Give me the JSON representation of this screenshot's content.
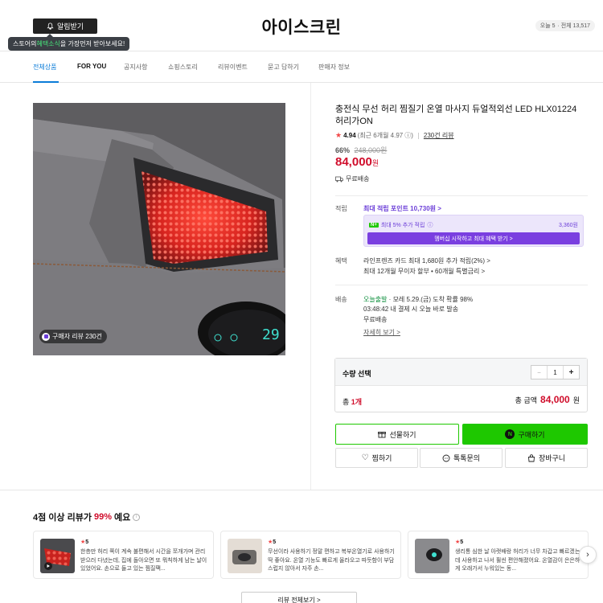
{
  "header": {
    "alarm_button": "알림받기",
    "alarm_tip_pre": "스토어의 ",
    "alarm_tip_highlight": "혜택소식",
    "alarm_tip_post": "을 가장먼저 받아보세요!",
    "store_name": "아이스크린",
    "visits_today": "오늘 5",
    "visits_total": "· 전체 13,517"
  },
  "nav": {
    "items": [
      "전체상품",
      "FOR YOU",
      "공지사항",
      "쇼핑스토리",
      "리뷰이벤트",
      "묻고 답하기",
      "판매자 정보"
    ]
  },
  "product": {
    "review_chip": "구매자 리뷰 230건",
    "title": "충전식 무선 허리 찜질기 온열 마사지 듀얼적외선 LED HLX01224 허리가ON",
    "rating": "4.94",
    "rating_sub": "(최근 6개월 4.97",
    "review_count": "230건 리뷰",
    "discount_pct": "66%",
    "original_price": "248,000원",
    "price": "84,000",
    "price_unit": "원",
    "shipping_free": "무료배송"
  },
  "benefits": {
    "points_label": "적립",
    "points_link": "최대 적립 포인트 10,730원 >",
    "npay_badge": "N+",
    "extra_points": "최대 5% 추가 적립",
    "extra_amount": "3,360원",
    "membership_button": "멤버십 시작하고 최대 혜택 받기 >",
    "card_label": "혜택",
    "card_line1": "라인프렌즈 카드 최대 1,680원 추가 적립(2%) >",
    "card_line2": "최대 12개월 무이자 할부 • 60개월 특별금리 >"
  },
  "delivery": {
    "label": "배송",
    "today_label": "오늘출발",
    "eta": " · 모레 5.29.(금) 도착 확률 98%",
    "cutoff": "03:48:42 내 결제 시 오늘 바로 발송",
    "fee": "무료배송",
    "details_link": "자세히 보기 >"
  },
  "order": {
    "qty_label": "수량 선택",
    "qty_value": "1",
    "minus": "−",
    "plus": "+",
    "total_prefix": "총 ",
    "total_count": "1개",
    "total_price_label": "총 금액",
    "total_price": "84,000",
    "total_price_unit": "원"
  },
  "actions": {
    "gift": "선물하기",
    "buy": "구매하기",
    "wish": "찜하기",
    "talk": "톡톡문의",
    "cart": "장바구니"
  },
  "reviews": {
    "heading_pre": "4점 이상 리뷰가 ",
    "heading_pct": "99%",
    "heading_post": "예요",
    "cards": [
      {
        "rating": "5",
        "text": "한층만 허리 쪽이 계속 불편해서 시간을 쪼개가며 관리받으러 다녔는데, 집에 돌아오면 또 뭐칙하게 남는 날이 있었어요. 손으로 들고 있는 찜질팩..."
      },
      {
        "rating": "5",
        "text": "무선이라 사용하기 정말 편하고 복부온열기로 사용하기 딱 좋아요. 온열 기능도 빠르게 올라오고 따듯함이 부담스럽지 않아서 자주 손..."
      },
      {
        "rating": "5",
        "text": "생리통 심한 날 아랫배랑 허리가 너무 차갑고 빠르겠는데 사용하고 나서 훨씬 편안해졌어요. 온열감이 은은하게 오래가서 누워있는 동..."
      }
    ],
    "all_button": "리뷰 전체보기 >"
  }
}
